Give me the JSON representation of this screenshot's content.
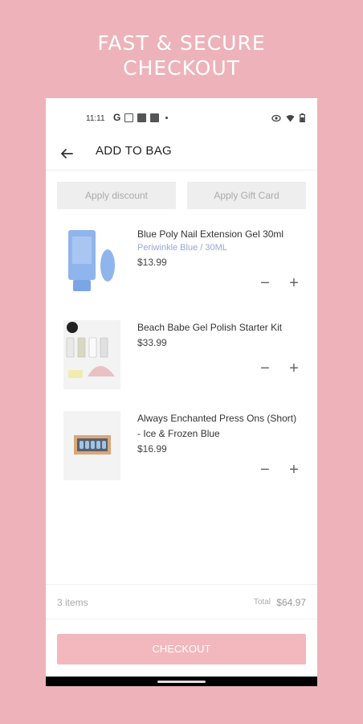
{
  "promo": {
    "headline_line1": "FAST & SECURE",
    "headline_line2": "CHECKOUT"
  },
  "status_bar": {
    "time": "11:11",
    "google_glyph": "G"
  },
  "app_bar": {
    "title": "ADD TO BAG",
    "back_icon": "arrow-left-icon"
  },
  "actions": {
    "discount_label": "Apply discount",
    "gift_card_label": "Apply Gift Card"
  },
  "cart": {
    "items": [
      {
        "name": "Blue Poly Nail Extension Gel 30ml",
        "variant": "Periwinkle Blue / 30ML",
        "price": "$13.99",
        "minus": "−",
        "plus": "+"
      },
      {
        "name": "Beach Babe Gel Polish Starter Kit",
        "price": "$33.99",
        "minus": "−",
        "plus": "+"
      },
      {
        "name": "Always Enchanted Press Ons (Short) - Ice & Frozen Blue",
        "price": "$16.99",
        "minus": "−",
        "plus": "+"
      }
    ]
  },
  "summary": {
    "count": "3 items",
    "total_label": "Total",
    "total_value": "$64.97"
  },
  "checkout": {
    "label": "CHECKOUT"
  },
  "colors": {
    "background": "#eeb3ba",
    "checkout_button": "#f2b8be",
    "variant_text": "#9aa6d4"
  }
}
